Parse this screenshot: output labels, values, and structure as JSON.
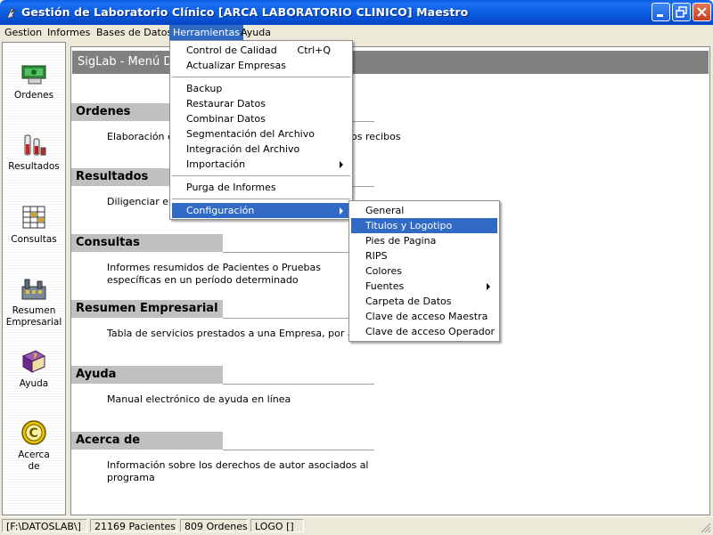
{
  "window": {
    "title": "Gestión de Laboratorio Clínico [ARCA LABORATORIO CLINICO] Maestro",
    "colors": {
      "titlebar": "#0a5ee0",
      "menu_highlight": "#316ac5",
      "section_header": "#c0c0c0",
      "panel_title": "#808080"
    }
  },
  "menubar": {
    "items": [
      {
        "label": "Gestion"
      },
      {
        "label": "Informes"
      },
      {
        "label": "Bases de Datos"
      },
      {
        "label": "Herramientas"
      },
      {
        "label": "Ayuda"
      }
    ]
  },
  "sidebar": {
    "items": [
      {
        "label": "Ordenes",
        "icon": "orders-icon"
      },
      {
        "label": "Resultados",
        "icon": "results-icon"
      },
      {
        "label": "Consultas",
        "icon": "queries-icon"
      },
      {
        "label": "Resumen Empresarial",
        "icon": "factory-icon"
      },
      {
        "label": "Ayuda",
        "icon": "help-book-icon"
      },
      {
        "label": "Acerca de",
        "icon": "copyright-icon"
      }
    ]
  },
  "main": {
    "panel_title": "SigLab - Menú De",
    "sections": [
      {
        "title": "Ordenes",
        "desc": "Elaboración e",
        "desc_tail": "os recibos"
      },
      {
        "title": "Resultados",
        "desc": "Diligenciar e im"
      },
      {
        "title": "Consultas",
        "desc": "Informes resumidos de Pacientes o Pruebas específicas en un período determinado"
      },
      {
        "title": "Resumen Empresarial",
        "desc": "Tabla de servicios prestados a una Empresa, por áreas"
      },
      {
        "title": "Ayuda",
        "desc": "Manual electrónico de ayuda en línea"
      },
      {
        "title": "Acerca de",
        "desc": "Información sobre los derechos de autor asociados al programa"
      }
    ]
  },
  "herramientas_menu": {
    "items": [
      {
        "label": "Control de Calidad",
        "shortcut": "Ctrl+Q"
      },
      {
        "label": "Actualizar Empresas"
      },
      {
        "label": "Backup"
      },
      {
        "label": "Restaurar Datos"
      },
      {
        "label": "Combinar Datos"
      },
      {
        "label": "Segmentación del Archivo"
      },
      {
        "label": "Integración del Archivo"
      },
      {
        "label": "Importación"
      },
      {
        "label": "Purga de Informes"
      },
      {
        "label": "Configuración"
      }
    ]
  },
  "configuracion_menu": {
    "items": [
      {
        "label": "General"
      },
      {
        "label": "Titulos y Logotipo"
      },
      {
        "label": "Pies de Pagina"
      },
      {
        "label": "RIPS"
      },
      {
        "label": "Colores"
      },
      {
        "label": "Fuentes"
      },
      {
        "label": "Carpeta de Datos"
      },
      {
        "label": "Clave de acceso Maestra"
      },
      {
        "label": "Clave de acceso Operador"
      }
    ]
  },
  "statusbar": {
    "path": "[F:\\DATOSLAB\\]",
    "patients": "21169 Pacientes",
    "orders": "809 Ordenes",
    "logo": "LOGO []"
  }
}
